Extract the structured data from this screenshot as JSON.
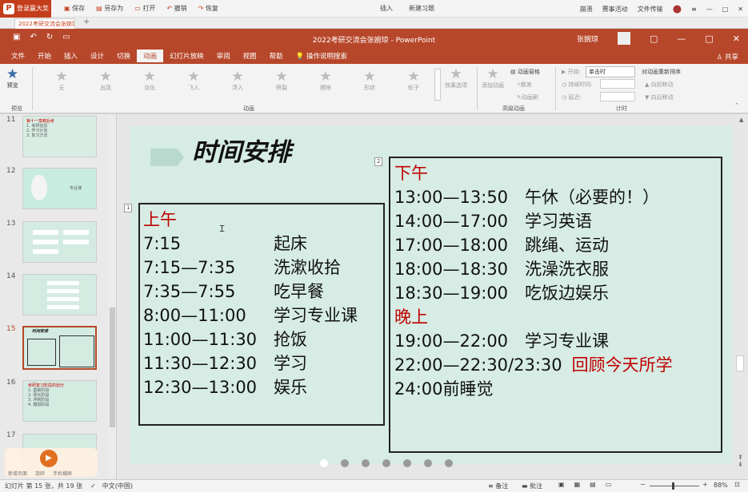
{
  "app": {
    "logo_label": "登录赢大奖",
    "toolbar": [
      "保存",
      "另存为",
      "打开",
      "撤销",
      "恢复"
    ],
    "insert": "插入",
    "new_note": "新建习题",
    "right_links": [
      "崩溃",
      "赛事活动",
      "文件传输"
    ]
  },
  "doc_tab": {
    "label": "2022考研交流会张婉琼..."
  },
  "window": {
    "title": "2022考研交流会张婉琼 - PowerPoint",
    "user": "张婉琼",
    "menu": [
      "文件",
      "开始",
      "插入",
      "设计",
      "切换",
      "动画",
      "幻灯片放映",
      "审阅",
      "视图",
      "帮助",
      "操作说明搜索"
    ],
    "active_menu": "动画",
    "share": "共享"
  },
  "ribbon": {
    "preview": "预览",
    "preview_group": "预览",
    "animations": [
      "无",
      "出现",
      "淡化",
      "飞入",
      "浮入",
      "劈裂",
      "擦除",
      "形状",
      "轮子"
    ],
    "effect_options": "效果选项",
    "animation_group": "动画",
    "add_animation": "添加动画",
    "animation_pane": "动画窗格",
    "trigger": "触发",
    "anim_painter": "动画刷",
    "advanced_group": "高级动画",
    "start_label": "开始:",
    "start_value": "单击时",
    "duration_label": "持续时间:",
    "delay_label": "延迟:",
    "timing_group": "计时",
    "reorder": "对动画重新排序",
    "move_earlier": "向前移动",
    "move_later": "向后移动"
  },
  "slides": [
    {
      "num": "11",
      "lines": [
        "第十一章教后考",
        "1. 考研信息",
        "2. 学习计划",
        "3. 复习方法"
      ]
    },
    {
      "num": "12",
      "caption": "专业课"
    },
    {
      "num": "13"
    },
    {
      "num": "14"
    },
    {
      "num": "15",
      "selected": true,
      "title": "时间安排"
    },
    {
      "num": "16",
      "lines": [
        "考研复习阶段的划分",
        "1. 基础阶段",
        "2. 强化阶段",
        "3. 冲刺阶段",
        "4. 模拟阶段"
      ]
    },
    {
      "num": "17"
    }
  ],
  "mini_player": [
    "新增页面",
    "旋转",
    "手机横屏"
  ],
  "slide": {
    "title": "时间安排",
    "box1_tag": "1",
    "box2_tag": "2",
    "morning": {
      "heading": "上午",
      "rows": [
        [
          "7:15",
          "起床"
        ],
        [
          "7:15—7:35",
          "洗漱收拾"
        ],
        [
          "7:35—7:55",
          "吃早餐"
        ],
        [
          "8:00—11:00",
          "学习专业课"
        ],
        [
          "11:00—11:30",
          "抢饭"
        ],
        [
          "11:30—12:30",
          "学习"
        ],
        [
          "12:30—13:00",
          "娱乐"
        ]
      ]
    },
    "afternoon": {
      "heading": "下午",
      "rows": [
        [
          "13:00—13:50",
          "午休（必要的！）"
        ],
        [
          "14:00—17:00",
          "学习英语"
        ],
        [
          "17:00—18:00",
          "跳绳、运动"
        ],
        [
          "18:00—18:30",
          "洗澡洗衣服"
        ],
        [
          "18:30—19:00",
          "吃饭边娱乐"
        ]
      ]
    },
    "evening": {
      "heading": "晚上",
      "rows": [
        {
          "time": "19:00—22:00",
          "text": "学习专业课"
        },
        {
          "time": "22:00—22:30/23:30",
          "text": "回顾今天所学",
          "red": true
        },
        {
          "time": "24:00前睡觉",
          "text": ""
        }
      ]
    }
  },
  "status": {
    "slide_info": "幻灯片 第 15 张，共 19 张",
    "lang": "中文(中国)",
    "notes": "备注",
    "comments": "批注",
    "zoom": "88%"
  },
  "colors": {
    "accent": "#b7472a",
    "slide_bg": "#d6ece4",
    "heading_red": "#c00000"
  }
}
